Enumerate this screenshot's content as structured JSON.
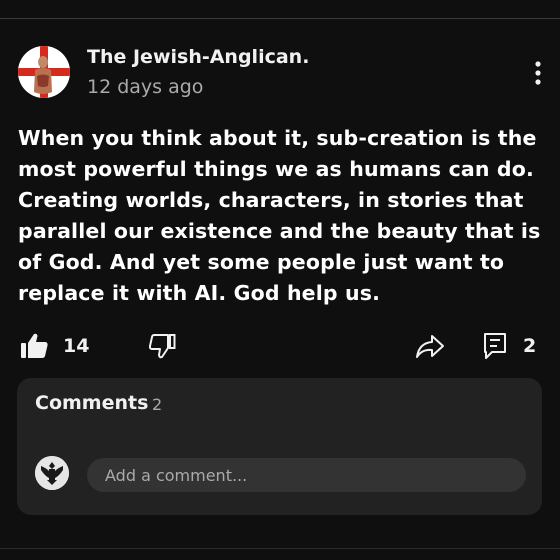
{
  "post": {
    "author": "The Jewish-Anglican.",
    "time": "12 days ago",
    "text": "When you think about it, sub-creation is the most powerful things we as humans can do. Creating worlds, characters, in stories that parallel our existence and the beauty that is of God. And yet some people just want to replace it with AI. God help us.",
    "avatar_icon": "st-george-cross-avatar",
    "more_icon": "more-vertical-icon"
  },
  "actions": {
    "likes": "14",
    "comments": "2",
    "like_icon": "thumbs-up-filled-icon",
    "dislike_icon": "thumbs-down-outline-icon",
    "share_icon": "share-arrow-icon",
    "comment_icon": "comment-bubble-icon"
  },
  "comments": {
    "title": "Comments",
    "count": "2",
    "placeholder": "Add a comment...",
    "user_avatar_icon": "eagle-crest-avatar"
  },
  "colors": {
    "background": "#0f0f0f",
    "panel": "#222222",
    "input": "#333333",
    "text": "#f1f1f1",
    "muted": "#aaaaaa",
    "avatar_red": "#d52b1e"
  }
}
